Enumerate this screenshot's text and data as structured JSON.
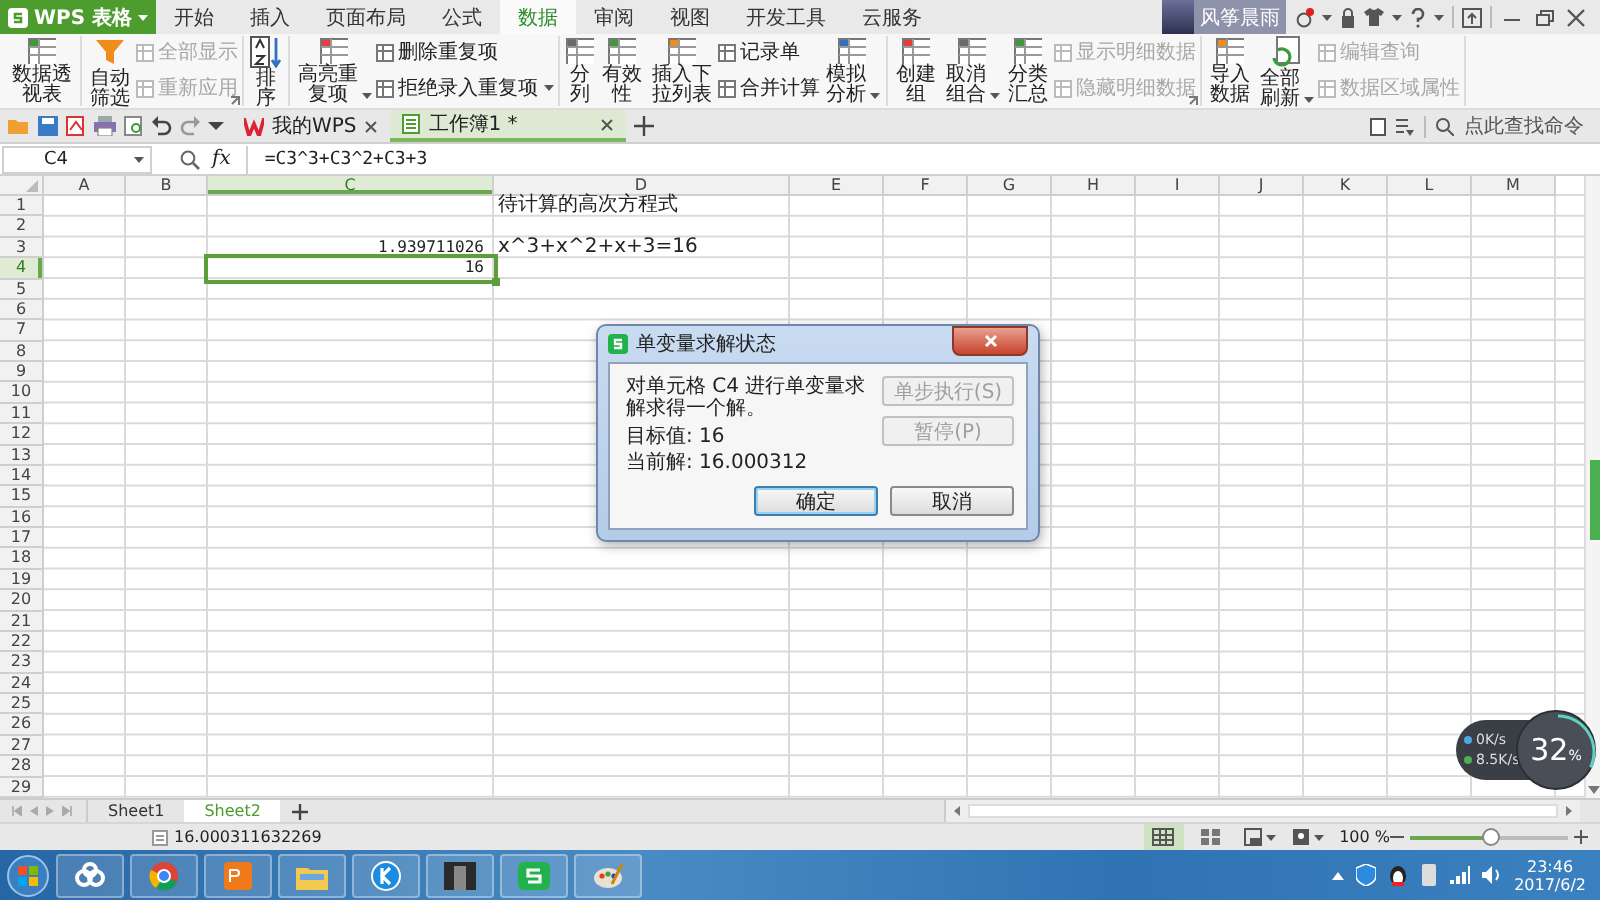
{
  "app": {
    "logo": "WPS 表格"
  },
  "menu_tabs": [
    {
      "label": "开始",
      "selected": false
    },
    {
      "label": "插入",
      "selected": false
    },
    {
      "label": "页面布局",
      "selected": false
    },
    {
      "label": "公式",
      "selected": false
    },
    {
      "label": "数据",
      "selected": true
    },
    {
      "label": "审阅",
      "selected": false
    },
    {
      "label": "视图",
      "selected": false
    },
    {
      "label": "开发工具",
      "selected": false
    },
    {
      "label": "云服务",
      "selected": false
    }
  ],
  "account": {
    "user": "风筝晨雨",
    "notification": true
  },
  "ribbon": {
    "groups": [
      {
        "items": [
          {
            "kind": "large",
            "label": "数据透视表",
            "dropdown": false,
            "disabled": false
          }
        ]
      },
      {
        "launcher": true,
        "items": [
          {
            "kind": "large",
            "label": "自动筛选",
            "dropdown": false,
            "disabled": false
          },
          {
            "kind": "stack",
            "items": [
              {
                "label": "全部显示",
                "dropdown": false,
                "disabled": true
              },
              {
                "label": "重新应用",
                "dropdown": false,
                "disabled": true
              }
            ]
          }
        ]
      },
      {
        "items": [
          {
            "kind": "large",
            "label": "排序",
            "dropdown": false,
            "disabled": false
          }
        ]
      },
      {
        "items": [
          {
            "kind": "large",
            "label": "高亮重复项",
            "dropdown": true,
            "disabled": false
          },
          {
            "kind": "stack",
            "items": [
              {
                "label": "删除重复项",
                "dropdown": false,
                "disabled": false
              },
              {
                "label": "拒绝录入重复项",
                "dropdown": true,
                "disabled": false
              }
            ]
          }
        ]
      },
      {
        "items": [
          {
            "kind": "large",
            "label": "分列",
            "dropdown": false,
            "disabled": false
          },
          {
            "kind": "large",
            "label": "有效性",
            "dropdown": false,
            "disabled": false
          },
          {
            "kind": "large",
            "label": "插入下拉列表",
            "dropdown": false,
            "disabled": false
          },
          {
            "kind": "stack",
            "items": [
              {
                "label": "记录单",
                "dropdown": false,
                "disabled": false
              },
              {
                "label": "合并计算",
                "dropdown": false,
                "disabled": false
              }
            ]
          },
          {
            "kind": "large",
            "label": "模拟分析",
            "dropdown": true,
            "disabled": false
          }
        ]
      },
      {
        "launcher": true,
        "items": [
          {
            "kind": "large",
            "label": "创建组",
            "dropdown": false,
            "disabled": false
          },
          {
            "kind": "large",
            "label": "取消组合",
            "dropdown": true,
            "disabled": false
          },
          {
            "kind": "large",
            "label": "分类汇总",
            "dropdown": false,
            "disabled": false
          },
          {
            "kind": "stack",
            "items": [
              {
                "label": "显示明细数据",
                "dropdown": false,
                "disabled": true
              },
              {
                "label": "隐藏明细数据",
                "dropdown": false,
                "disabled": true
              }
            ]
          }
        ]
      },
      {
        "items": [
          {
            "kind": "large",
            "label": "导入数据",
            "dropdown": false,
            "disabled": false
          },
          {
            "kind": "large",
            "label": "全部刷新",
            "dropdown": true,
            "disabled": false
          },
          {
            "kind": "stack",
            "items": [
              {
                "label": "编辑查询",
                "dropdown": false,
                "disabled": true
              },
              {
                "label": "数据区域属性",
                "dropdown": false,
                "disabled": true
              }
            ]
          }
        ]
      }
    ]
  },
  "doc_tabs": [
    {
      "label": "我的WPS",
      "selected": false
    },
    {
      "label": "工作簿1 *",
      "selected": true
    }
  ],
  "command_search": {
    "placeholder": "点此查找命令"
  },
  "formula_bar": {
    "name_box": "C4",
    "function_button": "fx",
    "formula": "=C3^3+C3^2+C3+3"
  },
  "sheet": {
    "columns": [
      "A",
      "B",
      "C",
      "D",
      "E",
      "F",
      "G",
      "H",
      "I",
      "J",
      "K",
      "L",
      "M"
    ],
    "rows": [
      {
        "number": "1",
        "cells": {
          "D": {
            "text": "待计算的高次方程式",
            "kind": "text",
            "selected": false
          }
        }
      },
      {
        "number": "2"
      },
      {
        "number": "3",
        "cells": {
          "C": {
            "text": "1.939711026",
            "kind": "number",
            "selected": false
          },
          "D": {
            "text": "x^3+x^2+x+3=16",
            "kind": "text",
            "selected": false
          }
        }
      },
      {
        "number": "4",
        "cells": {
          "C": {
            "text": "16",
            "kind": "number",
            "selected": true
          }
        }
      },
      {
        "number": "5"
      },
      {
        "number": "6"
      },
      {
        "number": "7"
      },
      {
        "number": "8"
      },
      {
        "number": "9"
      },
      {
        "number": "10"
      },
      {
        "number": "11"
      },
      {
        "number": "12"
      },
      {
        "number": "13"
      },
      {
        "number": "14"
      },
      {
        "number": "15"
      },
      {
        "number": "16"
      },
      {
        "number": "17"
      },
      {
        "number": "18"
      },
      {
        "number": "19"
      },
      {
        "number": "20"
      },
      {
        "number": "21"
      },
      {
        "number": "22"
      },
      {
        "number": "23"
      },
      {
        "number": "24"
      },
      {
        "number": "25"
      },
      {
        "number": "26"
      },
      {
        "number": "27"
      },
      {
        "number": "28"
      },
      {
        "number": "29"
      }
    ]
  },
  "sheet_tabs": [
    {
      "label": "Sheet1",
      "selected": false
    },
    {
      "label": "Sheet2",
      "selected": true
    }
  ],
  "status_bar": {
    "value": "16.000311632269",
    "view_modes": [
      {
        "selected": true
      },
      {
        "selected": false
      },
      {
        "selected": false
      },
      {
        "selected": false
      }
    ],
    "zoom": "100 %",
    "zoom_slider": {
      "level": 0.5
    }
  },
  "dialog": {
    "title": "单变量求解状态",
    "message": "对单元格 C4 进行单变量求解求得一个解。",
    "target": "目标值: 16",
    "current": "当前解: 16.000312",
    "buttons": [
      {
        "label": "单步执行(S)",
        "disabled": true,
        "default": false
      },
      {
        "label": "暂停(P)",
        "disabled": true,
        "default": false
      },
      {
        "label": "确定",
        "disabled": false,
        "default": true
      },
      {
        "label": "取消",
        "disabled": false,
        "default": false
      }
    ]
  },
  "net_monitor": {
    "upload": "0K/s",
    "download": "8.5K/s",
    "usage": "32",
    "unit": "%"
  },
  "taskbar": {
    "time": "23:46",
    "date": "2017/6/2"
  }
}
